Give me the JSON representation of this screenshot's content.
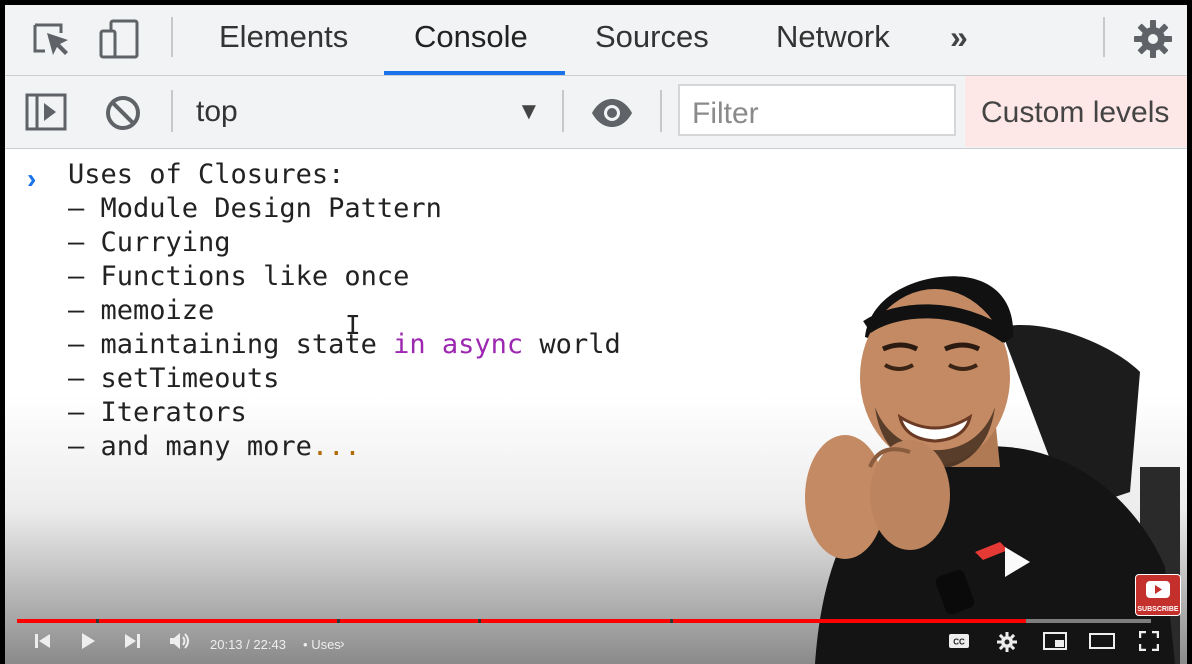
{
  "devtools": {
    "tabs": [
      {
        "label": "Elements",
        "active": false
      },
      {
        "label": "Console",
        "active": true
      },
      {
        "label": "Sources",
        "active": false
      },
      {
        "label": "Network",
        "active": false
      }
    ],
    "more_label": "»",
    "accent_color": "#1a73e8"
  },
  "toolbar": {
    "context": "top",
    "filter_placeholder": "Filter",
    "levels_label": "Custom levels"
  },
  "console": {
    "prompt_glyph": "›",
    "heading": "Uses of Closures:",
    "items": [
      {
        "dash": "– ",
        "text": "Module Design Pattern"
      },
      {
        "dash": "– ",
        "text": "Currying"
      },
      {
        "dash": "– ",
        "text": "Functions like once"
      },
      {
        "dash": "– ",
        "text": "memoize"
      },
      {
        "dash": "– ",
        "pre": "maintaining state ",
        "kw": "in async",
        "post": " world"
      },
      {
        "dash": "– ",
        "text": "setTimeouts"
      },
      {
        "dash": "– ",
        "text": "Iterators"
      },
      {
        "dash": "– ",
        "pre": "and many more",
        "ell": "..."
      }
    ],
    "keyword_color": "#9c27b0"
  },
  "player": {
    "current_time": "20:13",
    "duration": "22:43",
    "time_separator": " / ",
    "chapter_bullet": "•",
    "chapter": "Uses",
    "progress_fraction": 0.89,
    "progress_color": "#ff0000",
    "subscribe_label": "SUBSCRIBE"
  }
}
